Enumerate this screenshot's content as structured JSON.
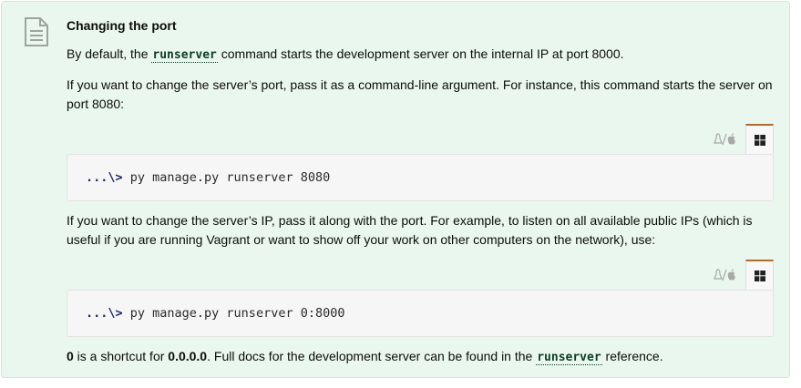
{
  "note": {
    "title": "Changing the port",
    "p1_before": "By default, the ",
    "p1_code": "runserver",
    "p1_after": " command starts the development server on the internal IP at port 8000.",
    "p2": "If you want to change the server’s port, pass it as a command-line argument. For instance, this command starts the server on port 8080:",
    "code1": {
      "prompt": "...\\>",
      "command": " py manage.py runserver 8080"
    },
    "p3": "If you want to change the server’s IP, pass it along with the port. For example, to listen on all available public IPs (which is useful if you are running Vagrant or want to show off your work on other computers on the network), use:",
    "code2": {
      "prompt": "...\\>",
      "command": " py manage.py runserver 0:8000"
    },
    "p4_b1": "0",
    "p4_t1": " is a shortcut for ",
    "p4_b2": "0.0.0.0",
    "p4_t2": ". Full docs for the development server can be found in the ",
    "p4_code": "runserver",
    "p4_t3": " reference."
  },
  "tabs": {
    "unix_label": "Linux/macOS",
    "windows_label": "Windows",
    "active": "windows"
  },
  "icons": {
    "note": "document-icon",
    "unix": "linux-apple-icon",
    "windows": "windows-icon"
  },
  "colors": {
    "note_bg": "#eaf7ee",
    "note_border": "#cfe9d6",
    "code_link": "#0c3c26",
    "tab_active_border": "#b26a2c"
  }
}
